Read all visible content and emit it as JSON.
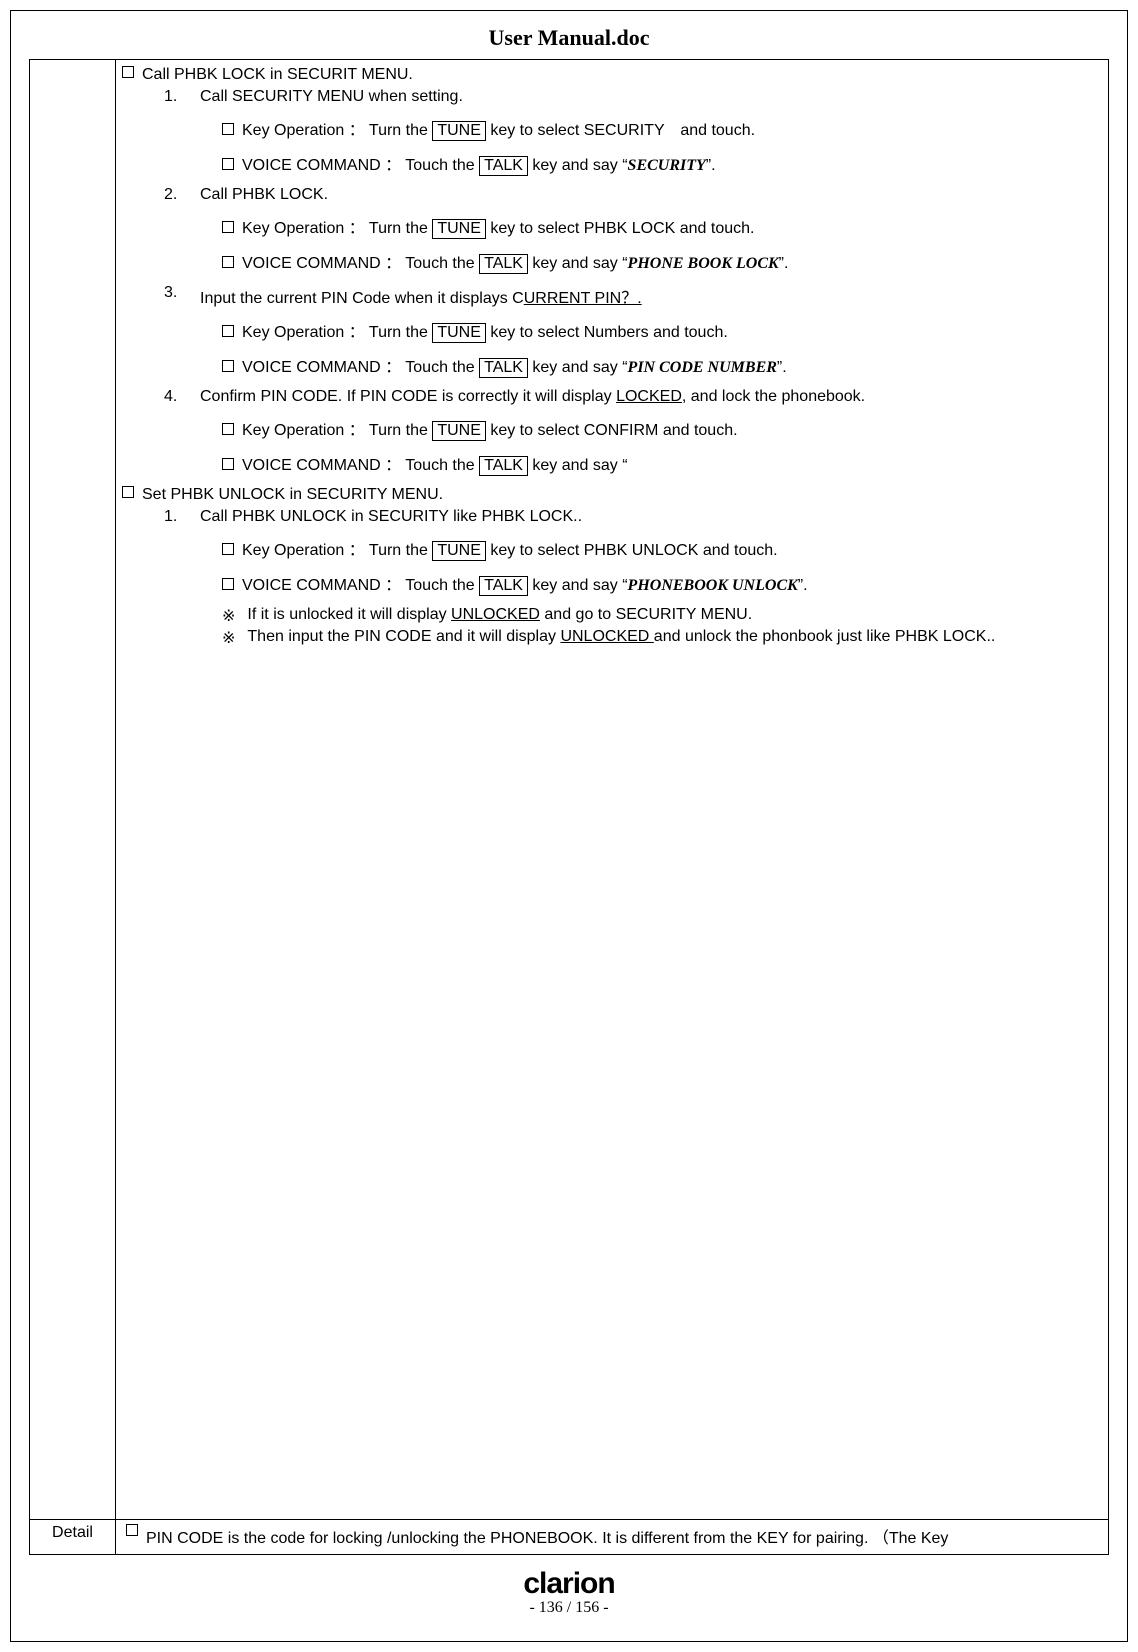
{
  "title": "User Manual.doc",
  "section1": {
    "heading": "Call PHBK LOCK in SECURIT MENU.",
    "steps": [
      {
        "num": "1.",
        "text": "Call SECURITY MENU when setting.",
        "keyop_pre": "Key Operation ： Turn the ",
        "keyop_key": "TUNE",
        "keyop_post": " key to select SECURITY　and touch.",
        "voice_pre": "VOICE COMMAND ： Touch the ",
        "voice_key": "TALK",
        "voice_mid": " key and say “",
        "voice_cmd": "SECURITY",
        "voice_end": "”."
      },
      {
        "num": "2.",
        "text": "Call PHBK LOCK.",
        "keyop_pre": "Key Operation ： Turn the ",
        "keyop_key": "TUNE",
        "keyop_post": " key to select PHBK LOCK and touch.",
        "voice_pre": "VOICE COMMAND ： Touch the ",
        "voice_key": "TALK",
        "voice_mid": " key and say “",
        "voice_cmd": "PHONE BOOK LOCK",
        "voice_end": "”."
      },
      {
        "num": "3.",
        "text_pre": "Input the current PIN Code when it displays C",
        "text_under": "URRENT PIN？.",
        "keyop_pre": "Key Operation ： Turn the ",
        "keyop_key": "TUNE",
        "keyop_post": " key to select Numbers and touch.",
        "voice_pre": "VOICE COMMAND ： Touch the ",
        "voice_key": "TALK",
        "voice_mid": " key and say “",
        "voice_cmd": "PIN CODE NUMBER",
        "voice_end": "”."
      },
      {
        "num": "4.",
        "text_pre": "Confirm PIN CODE. If PIN CODE is correctly it will display ",
        "text_under": "LOCKED",
        "text_post": ", and lock the phonebook.",
        "keyop_pre": "Key Operation ： Turn the ",
        "keyop_key": "TUNE",
        "keyop_post": " key to select CONFIRM and touch.",
        "voice_pre": "VOICE COMMAND ： Touch the ",
        "voice_key": "TALK",
        "voice_mid": " key and say “"
      }
    ]
  },
  "section2": {
    "heading": "Set PHBK UNLOCK in SECURITY MENU.",
    "step": {
      "num": "1.",
      "text": "Call PHBK UNLOCK in SECURITY like PHBK LOCK..",
      "keyop_pre": "Key Operation ： Turn the ",
      "keyop_key": "TUNE",
      "keyop_post": " key to select PHBK UNLOCK and touch.",
      "voice_pre": "VOICE COMMAND ： Touch the ",
      "voice_key": "TALK",
      "voice_mid": " key and say “",
      "voice_cmd": "PHONEBOOK UNLOCK",
      "voice_end": "”."
    },
    "notes": [
      {
        "mark": "※",
        "pre": "If it is unlocked it will display ",
        "under": "UNLOCKED",
        "post": " and go to SECURITY MENU."
      },
      {
        "mark": "※",
        "pre": "Then input the PIN CODE and it will display ",
        "under": "UNLOCKED ",
        "post": " and unlock the phonbook just like PHBK LOCK.."
      }
    ]
  },
  "detail": {
    "label": "Detail",
    "text": "PIN CODE is the code for locking /unlocking the PHONEBOOK. It is different from the KEY for pairing. （The Key"
  },
  "footer": {
    "logo": "clarion",
    "page": "- 136 / 156 -"
  }
}
